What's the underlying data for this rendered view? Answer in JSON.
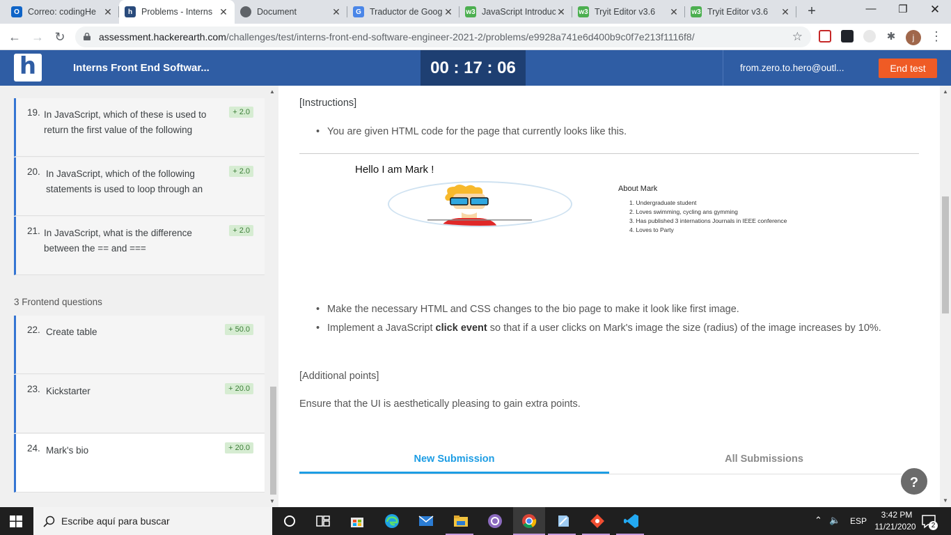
{
  "browser": {
    "tabs": [
      {
        "title": "Correo: codingHe",
        "icon": "outlook-icon",
        "color": "#0f64c7",
        "glyph": "O",
        "active": false
      },
      {
        "title": "Problems - Interns",
        "icon": "hackerearth-icon",
        "color": "#2a4b7c",
        "glyph": "h",
        "active": true
      },
      {
        "title": "Document",
        "icon": "globe-icon",
        "color": "#5f6368",
        "glyph": "",
        "active": false
      },
      {
        "title": "Traductor de Goog",
        "icon": "google-translate-icon",
        "color": "#4a86e8",
        "glyph": "G",
        "active": false
      },
      {
        "title": "JavaScript Introduc",
        "icon": "w3schools-icon",
        "color": "#4caf50",
        "glyph": "w3",
        "active": false
      },
      {
        "title": "Tryit Editor v3.6",
        "icon": "w3schools-icon",
        "color": "#4caf50",
        "glyph": "w3",
        "active": false
      },
      {
        "title": "Tryit Editor v3.6",
        "icon": "w3schools-icon",
        "color": "#4caf50",
        "glyph": "w3",
        "active": false
      }
    ],
    "url_host": "assessment.hackerearth.com",
    "url_path": "/challenges/test/interns-front-end-software-engineer-2021-2/problems/e9928a741e6d400b9c0f7e213f1116f8/",
    "profile_initial": "j"
  },
  "header": {
    "logo": "h",
    "title": "Interns Front End Softwar...",
    "timer": "00 : 17 : 06",
    "user": "from.zero.to.hero@outl...",
    "end_test": "End test"
  },
  "sidebar": {
    "questions_top": [
      {
        "num": "19.",
        "text": "In JavaScript, which of these is used to return the first value of the following",
        "score": "+ 2.0"
      },
      {
        "num": "20.",
        "text": "In JavaScript, which of the following statements is used to loop through an",
        "score": "+ 2.0"
      },
      {
        "num": "21.",
        "text": "In JavaScript, what is the difference between the == and ===",
        "score": "+ 2.0"
      }
    ],
    "section_label": "3 Frontend questions",
    "questions_frontend": [
      {
        "num": "22.",
        "text": "Create table",
        "score": "+ 50.0"
      },
      {
        "num": "23.",
        "text": "Kickstarter",
        "score": "+ 20.0"
      },
      {
        "num": "24.",
        "text": "Mark's bio",
        "score": "+ 20.0"
      }
    ]
  },
  "problem": {
    "instructions_heading": "[Instructions]",
    "bullet_1": "You are given HTML code for the page that currently looks like this.",
    "preview": {
      "hello": "Hello I am Mark !",
      "about_title": "About Mark",
      "about_items": [
        "Undergraduate student",
        "Loves swimming, cycling ans gymming",
        "Has published 3 internations Journals in IEEE conference",
        "Loves to Party"
      ]
    },
    "bullet_2": "Make the necessary HTML and CSS changes to the bio page to make it look like first image.",
    "bullet_3_pre": "Implement a JavaScript ",
    "bullet_3_bold": "click event",
    "bullet_3_post": " so that if a user clicks on Mark's image the size (radius) of the image increases by 10%.",
    "additional_heading": "[Additional points]",
    "additional_text": "Ensure that the UI is aesthetically pleasing to gain extra points.",
    "tab_new": "New Submission",
    "tab_all": "All Submissions",
    "help": "?"
  },
  "taskbar": {
    "search_placeholder": "Escribe aquí para buscar",
    "lang": "ESP",
    "time": "3:42 PM",
    "date": "11/21/2020",
    "notifications": "2"
  }
}
